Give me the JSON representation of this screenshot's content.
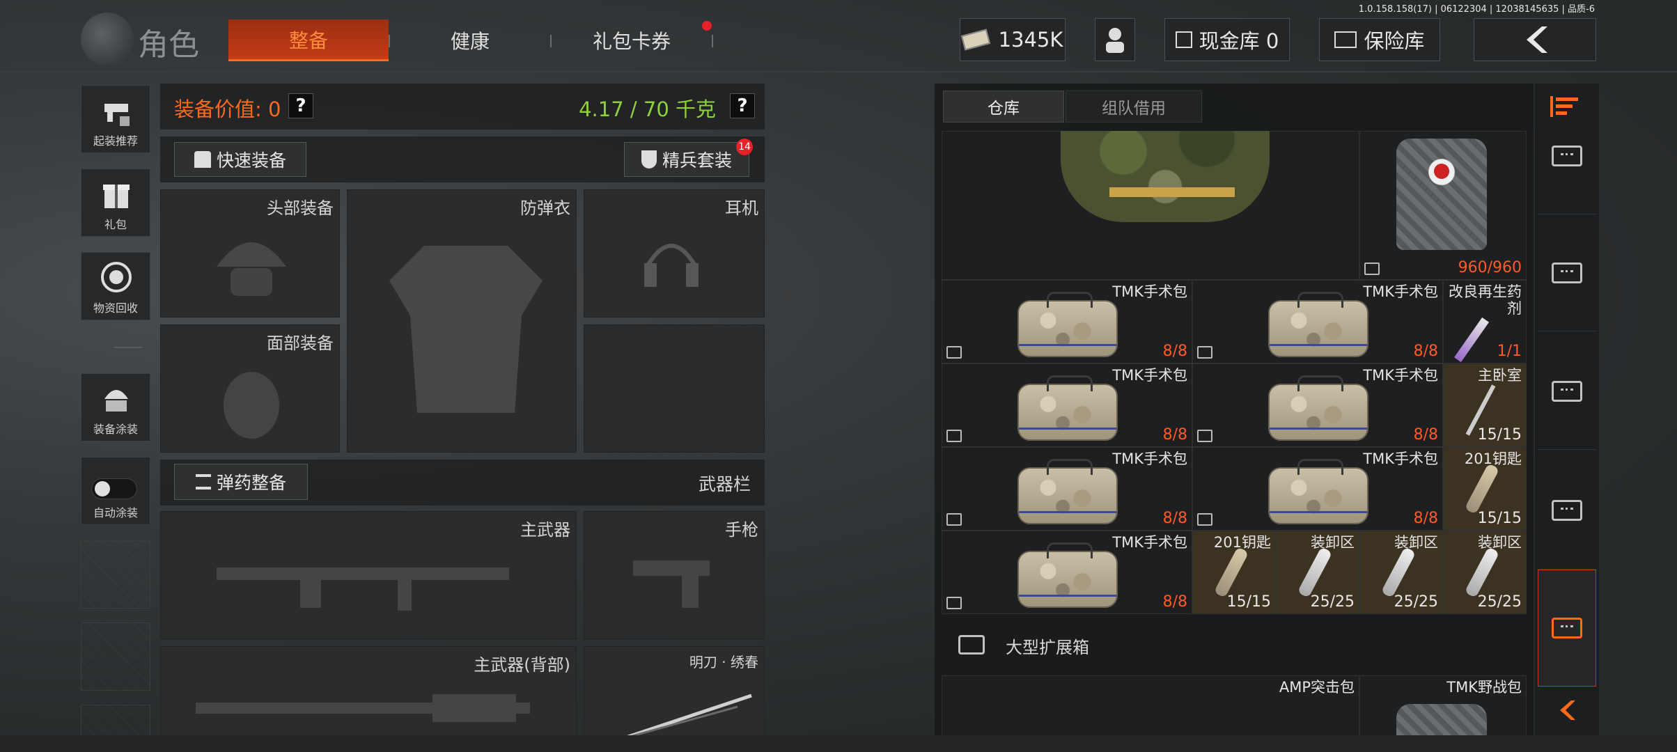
{
  "version": "1.0.158.158(17) | 06122304 | 12038145635 | 品质-6",
  "header": {
    "title": "角色",
    "tabs": [
      {
        "label": "整备",
        "active": true
      },
      {
        "label": "健康",
        "active": false
      },
      {
        "label": "礼包卡券",
        "active": false
      }
    ],
    "currency": "1345K",
    "cash_vault": "现金库 0",
    "safe": "保险库"
  },
  "sidebar": {
    "items": [
      {
        "label": "起装推荐",
        "icon": "gun-recommend-icon"
      },
      {
        "label": "礼包",
        "icon": "gift-icon"
      },
      {
        "label": "物资回收",
        "icon": "recycle-icon"
      },
      {
        "label": "装备涂装",
        "icon": "helmet-paint-icon"
      },
      {
        "label": "自动涂装",
        "icon": "toggle-icon",
        "toggle_on": false
      }
    ]
  },
  "loadout": {
    "value_label": "装备价值: 0",
    "weight": "4.17 / 70 千克",
    "quick_equip": "快速装备",
    "elite_kit": "精兵套装",
    "elite_badge": "14",
    "slots": {
      "head": "头部装备",
      "armor": "防弹衣",
      "headset": "耳机",
      "face": "面部装备"
    },
    "ammo_btn": "弹药整备",
    "weapon_bar": "武器栏",
    "weapons": {
      "primary": "主武器",
      "pistol": "手枪",
      "primary_back": "主武器(背部)",
      "melee": "明刀 · 绣春"
    }
  },
  "storage": {
    "tabs": [
      {
        "label": "仓库",
        "active": true
      },
      {
        "label": "组队借用",
        "active": false
      }
    ],
    "top_backpack_count": "960/960",
    "items": [
      {
        "name": "TMK手术包",
        "count": "8/8"
      },
      {
        "name": "TMK手术包",
        "count": "8/8"
      },
      {
        "name": "改良再生药剂",
        "count": "1/1"
      },
      {
        "name": "TMK手术包",
        "count": "8/8"
      },
      {
        "name": "TMK手术包",
        "count": "8/8"
      },
      {
        "name": "主卧室",
        "count": "15/15"
      },
      {
        "name": "TMK手术包",
        "count": "8/8"
      },
      {
        "name": "TMK手术包",
        "count": "8/8"
      },
      {
        "name": "201钥匙",
        "count": "15/15"
      },
      {
        "name": "TMK手术包",
        "count": "8/8"
      },
      {
        "name": "201钥匙",
        "count": "15/15"
      },
      {
        "name": "装卸区",
        "count": "25/25"
      },
      {
        "name": "装卸区",
        "count": "25/25"
      },
      {
        "name": "装卸区",
        "count": "25/25"
      }
    ],
    "section_title": "大型扩展箱",
    "section_items": [
      {
        "name": "AMP突击包"
      },
      {
        "name": "TMK野战包"
      }
    ]
  },
  "colors": {
    "accent": "#ff6a1a",
    "value_orange": "#ff6a1a",
    "weight_green": "#8fd23a",
    "count_red": "#ff5a2a"
  }
}
